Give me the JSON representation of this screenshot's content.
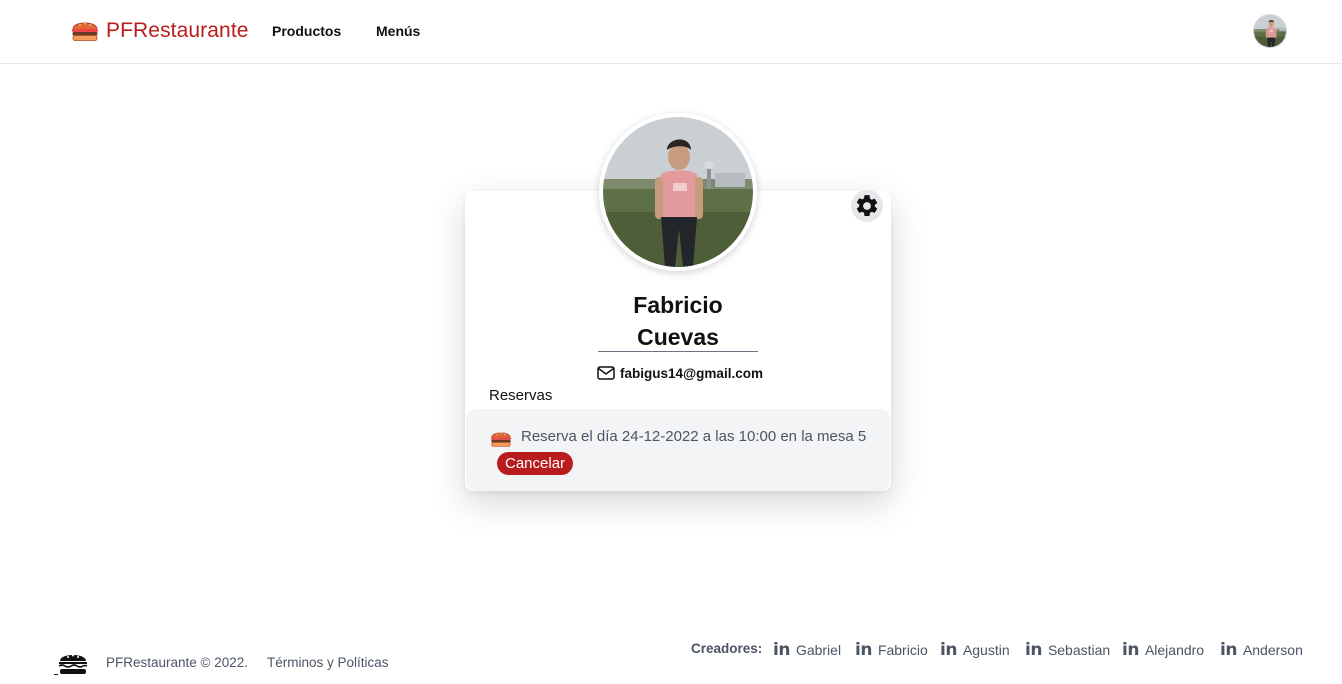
{
  "header": {
    "brand": "PFRestaurante",
    "nav_items": [
      {
        "label": "Productos"
      },
      {
        "label": "Menús"
      }
    ]
  },
  "profile": {
    "first_name": "Fabricio",
    "last_name": "Cuevas",
    "email": "fabigus14@gmail.com",
    "reservations_label": "Reservas",
    "reservations": [
      {
        "text": "Reserva el día 24-12-2022 a las 10:00 en la mesa 5",
        "cancel_label": "Cancelar"
      }
    ]
  },
  "footer": {
    "copyright": "PFRestaurante © 2022.",
    "terms": "Términos y Políticas",
    "creators_label": "Creadores:",
    "creators": [
      "Gabriel",
      "Fabricio",
      "Agustin",
      "Sebastian",
      "Alejandro",
      "Anderson"
    ]
  },
  "icons": {
    "brand": "burger-icon",
    "settings": "gear-icon",
    "email": "envelope-icon",
    "reservation": "burger-icon",
    "creator": "linkedin-icon"
  },
  "colors": {
    "brand": "#b91c1c",
    "cancel_button": "#b91c1c",
    "reservation_bg": "#f3f4f6",
    "muted_text": "#4b5563"
  }
}
